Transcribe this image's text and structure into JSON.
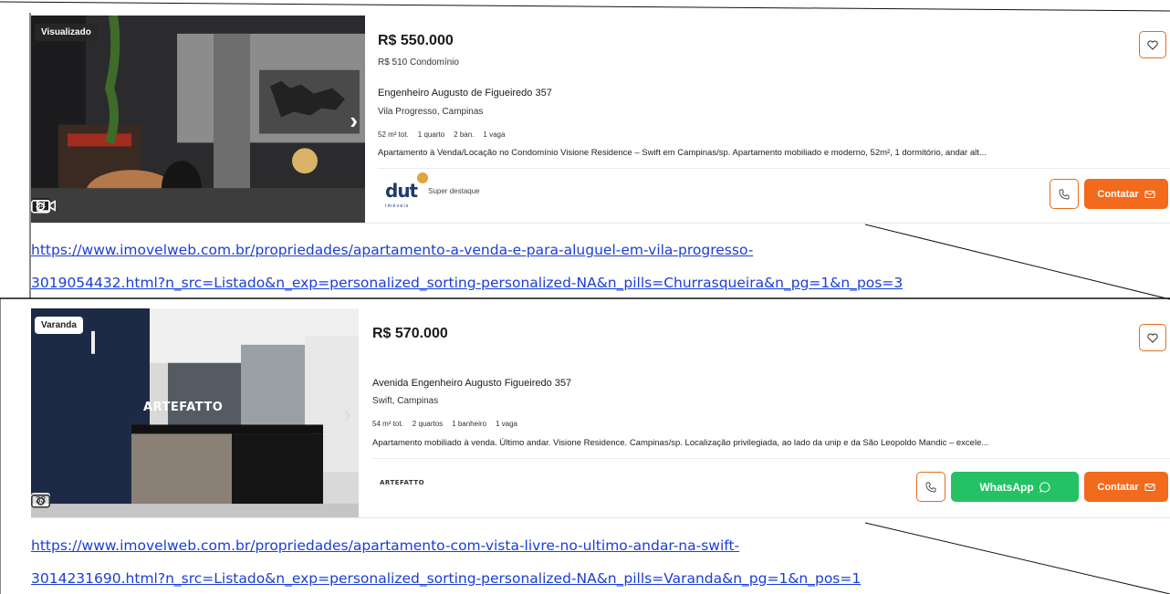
{
  "listings": [
    {
      "tag": "Visualizado",
      "photo_count": "34",
      "price": "R$ 550.000",
      "condominium": "R$ 510 Condomínio",
      "address": "Engenheiro Augusto de Figueiredo 357",
      "locality": "Vila Progresso, Campinas",
      "features": [
        "52 m² tot.",
        "1 quarto",
        "2 ban.",
        "1 vaga"
      ],
      "description": "Apartamento à Venda/Locação no Condomínio Visione Residence – Swift em Campinas/sp. Apartamento mobiliado e moderno, 52m², 1 dormitório, andar alt...",
      "advertiser_logo": "dut",
      "advertiser_logo_sub": "imóveis",
      "badge": "Super destaque",
      "contact_label": "Contatar",
      "url_line1": "https://www.imovelweb.com.br/propriedades/apartamento-a-venda-e-para-aluguel-em-vila-progresso-",
      "url_line2": "3019054432.html?n_src=Listado&n_exp=personalized_sorting-personalized-NA&n_pills=Churrasqueira&n_pg=1&n_pos=3"
    },
    {
      "tag": "Varanda",
      "photo_count": "33",
      "price": "R$ 570.000",
      "address": "Avenida Engenheiro Augusto Figueiredo 357",
      "locality": "Swift, Campinas",
      "features": [
        "54 m² tot.",
        "2 quartos",
        "1 banheiro",
        "1 vaga"
      ],
      "description": "Apartamento mobiliado à venda. Último andar. Visione Residence. Campinas/sp. Localização privilegiada, ao lado da unip e da São Leopoldo Mandic – excele...",
      "photo_overlay_text": "ARTEFATTO",
      "advertiser_logo": "ARTEFATTO",
      "whatsapp_label": "WhatsApp",
      "contact_label": "Contatar",
      "url_line1": "https://www.imovelweb.com.br/propriedades/apartamento-com-vista-livre-no-ultimo-andar-na-swift-",
      "url_line2": "3014231690.html?n_src=Listado&n_exp=personalized_sorting-personalized-NA&n_pills=Varanda&n_pg=1&n_pos=1"
    }
  ],
  "icons": {
    "favorite": "heart-icon",
    "phone": "phone-icon",
    "mail": "mail-icon",
    "whatsapp": "whatsapp-icon",
    "camera": "camera-icon",
    "video": "video-icon",
    "next": "chevron-right-icon"
  },
  "colors": {
    "accent": "#f26a1b",
    "whatsapp": "#25c165",
    "link": "#1a3ed6"
  }
}
